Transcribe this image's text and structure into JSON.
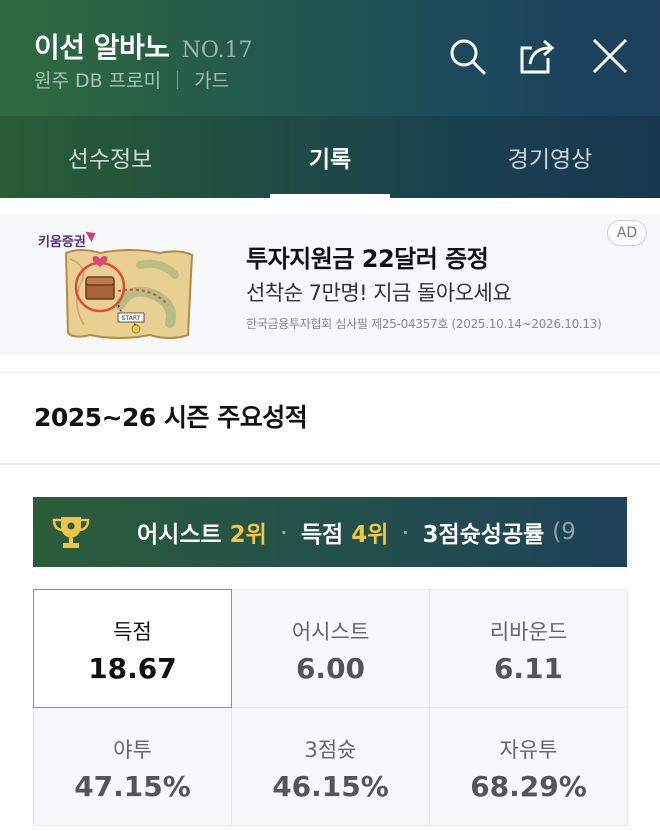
{
  "header": {
    "player_name": "이선 알바노",
    "player_no": "NO.17",
    "team": "원주 DB 프로미",
    "position": "가드",
    "icons": [
      "search-icon",
      "share-icon",
      "close-icon"
    ]
  },
  "tabs": [
    {
      "label": "선수정보",
      "active": false
    },
    {
      "label": "기록",
      "active": true
    },
    {
      "label": "경기영상",
      "active": false
    }
  ],
  "ad": {
    "brand": "키움증권",
    "title": "투자지원금 22달러 증정",
    "description": "선착순 7만명! 지금 돌아오세요",
    "note": "한국금융투자협회 심사필 제25-04357호 (2025.10.14~2026.10.13)",
    "badge": "AD",
    "image_start_label": "START"
  },
  "season": {
    "title": "2025~26 시즌 주요성적",
    "rankings": [
      {
        "label": "어시스트",
        "rank": "2위"
      },
      {
        "label": "득점",
        "rank": "4위"
      },
      {
        "label": "3점슛성공률",
        "rank": "(9"
      }
    ],
    "stats": [
      {
        "label": "득점",
        "value": "18.67",
        "selected": true
      },
      {
        "label": "어시스트",
        "value": "6.00",
        "selected": false
      },
      {
        "label": "리바운드",
        "value": "6.11",
        "selected": false
      },
      {
        "label": "야투",
        "value": "47.15%",
        "selected": false
      },
      {
        "label": "3점슛",
        "value": "46.15%",
        "selected": false
      },
      {
        "label": "자유투",
        "value": "68.29%",
        "selected": false
      }
    ]
  },
  "colors": {
    "header_green": "#2f6b3f",
    "header_blue": "#1b3f5c",
    "rank_highlight": "#f0c545"
  }
}
